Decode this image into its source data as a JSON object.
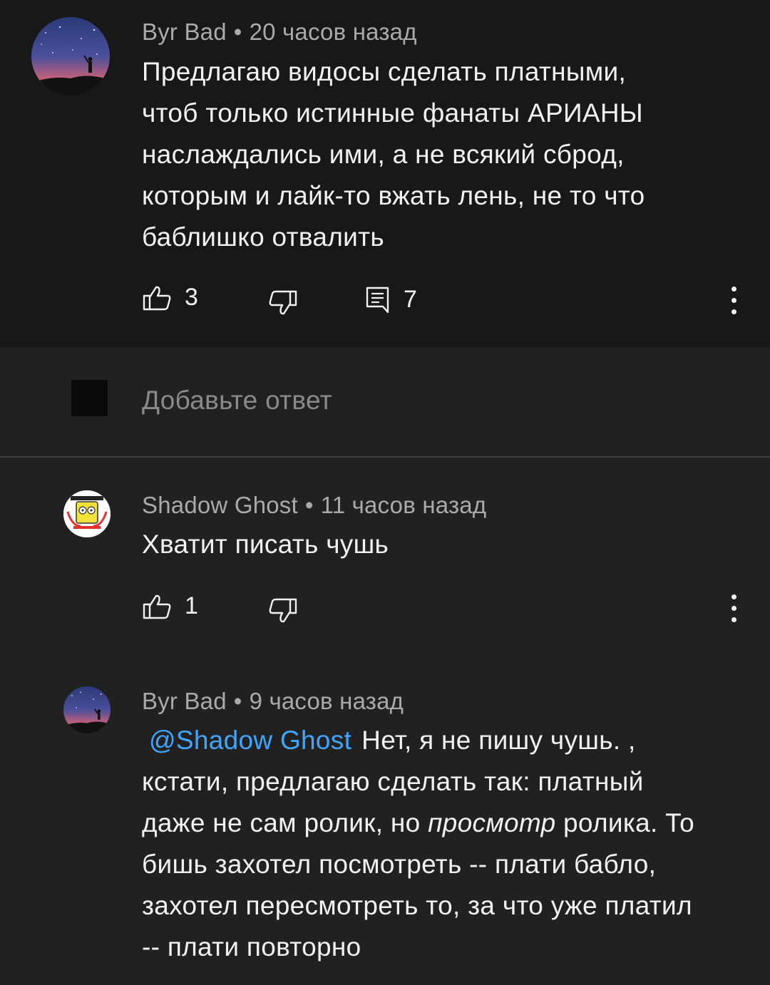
{
  "comment_main": {
    "author": "Byr Bad",
    "separator": "•",
    "time": "20 часов назад",
    "lines": [
      "Предлагаю видосы сделать платными,",
      "чтоб только истинные фанаты АРИАНЫ",
      "наслаждались ими, а не всякий сброд,",
      "которым и лайк-то вжать лень, не то что",
      "баблишко отвалить"
    ],
    "likes": "3",
    "replies": "7"
  },
  "reply_box": {
    "placeholder": "Добавьте ответ"
  },
  "reply_1": {
    "author": "Shadow Ghost",
    "separator": "•",
    "time": "11 часов назад",
    "text": "Хватит писать чушь",
    "likes": "1"
  },
  "reply_2": {
    "author": "Byr Bad",
    "separator": "•",
    "time": "9 часов назад",
    "mention": "@Shadow Ghost",
    "line1_rest": "Нет, я не пишу чушь. ,",
    "line2": "кстати, предлагаю сделать так: платный",
    "line3_before": "даже не сам ролик, но ",
    "line3_italic": "просмотр",
    "line3_after": " ролика. То",
    "line4": "бишь захотел посмотреть -- плати бабло,",
    "line5": "захотел пересмотреть то, за что уже платил",
    "line6": "-- плати повторно"
  },
  "icons": {
    "like": "thumb-up-icon",
    "dislike": "thumb-down-icon",
    "reply": "comment-icon",
    "more": "more-vert-icon"
  },
  "colors": {
    "background": "#212121",
    "highlighted_comment": "#181818",
    "text": "#f1f1f1",
    "meta": "#aaaaaa",
    "mention": "#3ea6ff"
  }
}
